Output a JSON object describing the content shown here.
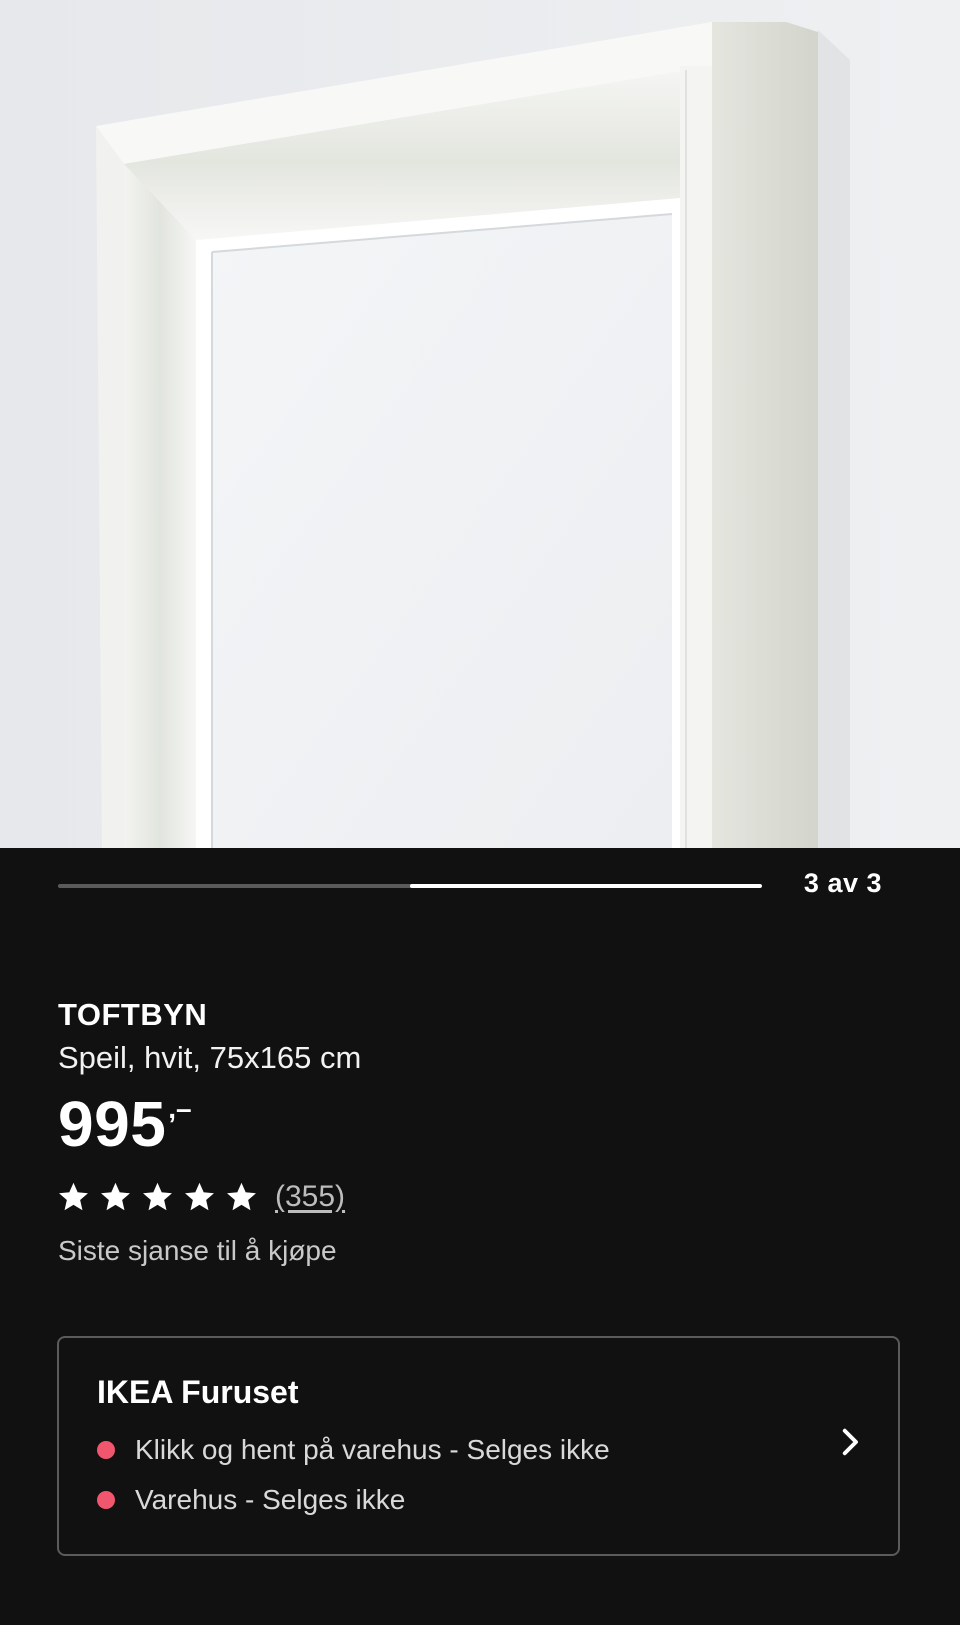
{
  "gallery": {
    "image_label": "TOFTBYN mirror frame detail",
    "position_label": "3 av 3",
    "current_index": 3,
    "total": 3
  },
  "product": {
    "name": "TOFTBYN",
    "description": "Speil, hvit, 75x165 cm",
    "price": "995",
    "price_suffix": ",–",
    "rating_stars": 5,
    "review_count": "(355)",
    "availability_note": "Siste sjanse til å kjøpe"
  },
  "store": {
    "name": "IKEA Furuset",
    "lines": [
      "Klikk og hent på varehus - Selges ikke",
      "Varehus - Selges ikke"
    ],
    "status_color": "#f0566d"
  },
  "colors": {
    "background": "#111111",
    "text": "#ffffff"
  }
}
